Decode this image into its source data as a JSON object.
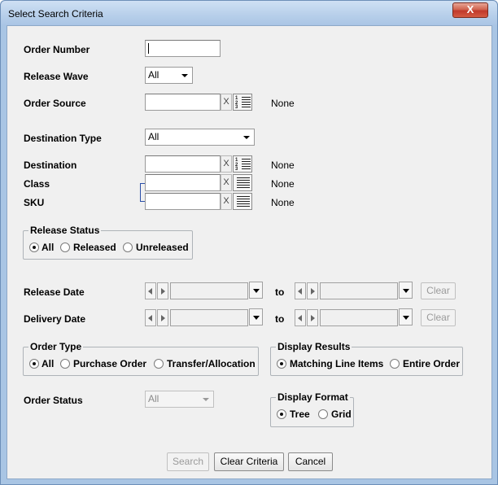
{
  "window": {
    "title": "Select Search Criteria",
    "close_label": "X"
  },
  "fields": {
    "order_number": {
      "label": "Order Number",
      "value": ""
    },
    "release_wave": {
      "label": "Release Wave",
      "selected": "All"
    },
    "order_source": {
      "label": "Order Source",
      "value": "",
      "clear_label": "X",
      "selection": "None"
    },
    "destination_type": {
      "label": "Destination Type",
      "selected": "All"
    },
    "destination": {
      "label": "Destination",
      "value": "",
      "clear_label": "X",
      "selection": "None"
    },
    "class": {
      "label": "Class",
      "value": "",
      "clear_label": "X",
      "selection": "None"
    },
    "sku": {
      "label": "SKU",
      "value": "",
      "clear_label": "X",
      "selection": "None"
    }
  },
  "release_status": {
    "title": "Release Status",
    "options": [
      "All",
      "Released",
      "Unreleased"
    ],
    "selected": "All"
  },
  "dates": {
    "to_label": "to",
    "clear_label": "Clear",
    "release_date": {
      "label": "Release Date"
    },
    "delivery_date": {
      "label": "Delivery Date"
    }
  },
  "order_type": {
    "title": "Order Type",
    "options": [
      "All",
      "Purchase Order",
      "Transfer/Allocation"
    ],
    "selected": "All"
  },
  "display_results": {
    "title": "Display Results",
    "options": [
      "Matching Line Items",
      "Entire Order"
    ],
    "selected": "Matching Line Items"
  },
  "order_status": {
    "label": "Order Status",
    "selected": "All"
  },
  "display_format": {
    "title": "Display Format",
    "options": [
      "Tree",
      "Grid"
    ],
    "selected": "Tree"
  },
  "buttons": {
    "search": "Search",
    "clear_criteria": "Clear Criteria",
    "cancel": "Cancel"
  },
  "icons": {
    "list_picker": "numbered-list-icon",
    "list_picker_plain": "list-icon"
  }
}
